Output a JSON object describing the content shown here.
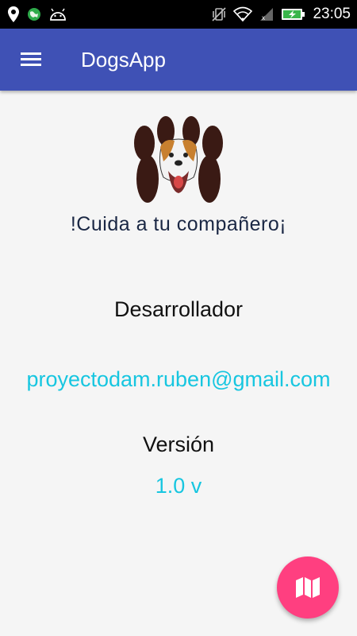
{
  "status_bar": {
    "time": "23:05",
    "left_icons": [
      "location-pin-icon",
      "globe-icon",
      "android-icon"
    ],
    "right_icons": [
      "vibrate-off-icon",
      "wifi-icon",
      "signal-icon",
      "battery-charging-icon"
    ]
  },
  "app_bar": {
    "title": "DogsApp",
    "menu_icon": "hamburger-menu-icon",
    "color": "#3f51b5"
  },
  "logo": {
    "icon": "dog-paw-logo",
    "tagline": "!Cuida a tu compañero¡"
  },
  "about": {
    "developer_label": "Desarrollador",
    "developer_email": "proyectodam.ruben@gmail.com",
    "version_label": "Versión",
    "version_value": "1.0 v"
  },
  "fab": {
    "icon": "map-icon",
    "color": "#ff3f80"
  },
  "colors": {
    "accent_text": "#17c6e0",
    "background": "#f5f5f5"
  }
}
